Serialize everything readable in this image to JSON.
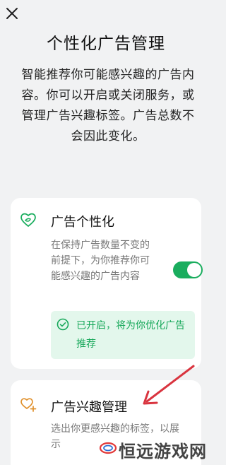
{
  "header": {
    "close_icon": "close-icon",
    "title": "个性化广告管理"
  },
  "description": "智能推荐你可能感兴趣的广告内容。你可以开启或关闭服务，或管理广告兴趣标签。广告总数不会因此变化。",
  "personalization_card": {
    "icon": "heart-leaf-icon",
    "title": "广告个性化",
    "description": "在保持广告数量不变的前提下，为你推荐你可能感兴趣的广告内容",
    "toggle_on": true,
    "notice": "已开启，将为你优化广告推荐",
    "accent_color": "#1aad5e",
    "notice_bg": "#e3f7ec"
  },
  "interest_card": {
    "icon": "hearts-plus-icon",
    "title": "广告兴趣管理",
    "description": "选出你更感兴趣的标签，以展示"
  },
  "annotation": {
    "arrow_color": "#d9343f"
  },
  "watermark": {
    "text": "恒远游戏网"
  }
}
